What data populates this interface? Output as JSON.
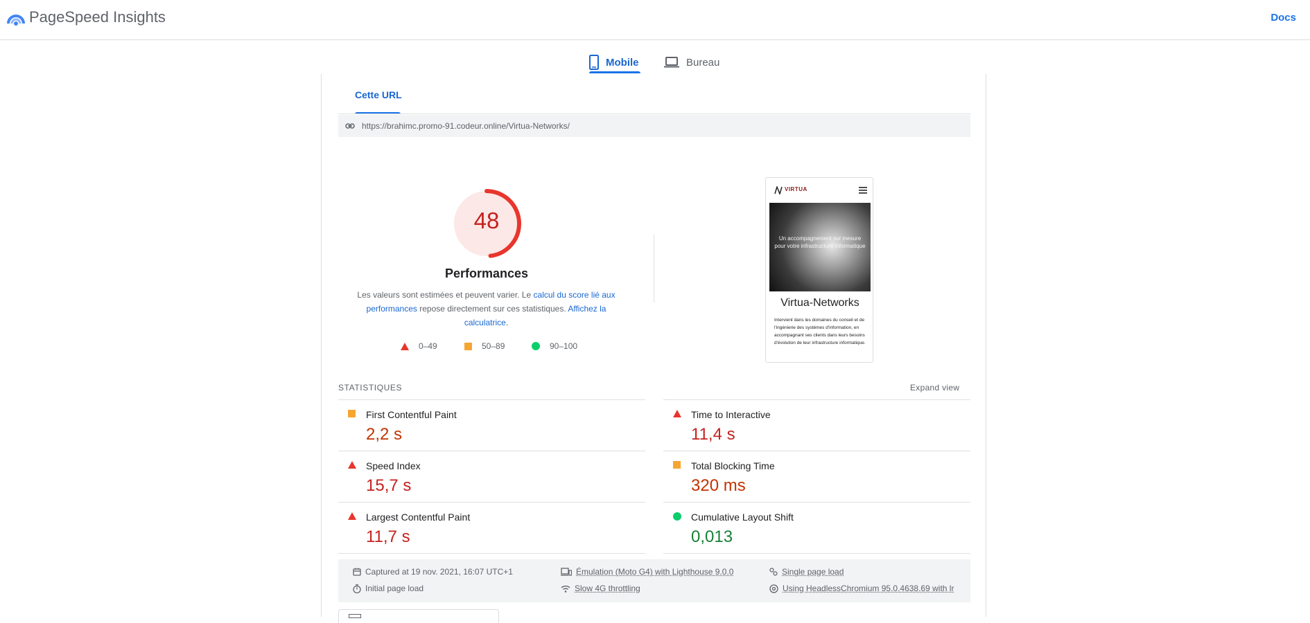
{
  "header": {
    "brand": "PageSpeed Insights",
    "docs_label": "Docs"
  },
  "device_tabs": [
    {
      "label": "Mobile",
      "selected": true
    },
    {
      "label": "Bureau",
      "selected": false
    }
  ],
  "url_tab": {
    "label": "Cette URL"
  },
  "url": "https://brahimc.promo-91.codeur.online/Virtua-Networks/",
  "score": {
    "value": "48",
    "fraction": 0.48,
    "title": "Performances",
    "desc_1": "Les valeurs sont estimées et peuvent varier. Le ",
    "desc_link_1": "calcul du score lié aux performances",
    "desc_2": " repose directement sur ces statistiques. ",
    "desc_link_2": "Affichez la calculatrice",
    "desc_3": ".",
    "legend": [
      {
        "range": "0–49",
        "shape": "triangle",
        "color": "#e8362d"
      },
      {
        "range": "50–89",
        "shape": "square",
        "color": "#f7a531"
      },
      {
        "range": "90–100",
        "shape": "circle",
        "color": "#0cce6b"
      }
    ]
  },
  "preview": {
    "logo_text": "VIRTUA",
    "hero_text_1": "Un accompagnement sur mesure",
    "hero_text_2": "pour votre infrastructure informatique",
    "title": "Virtua-Networks",
    "body": "Intervient dans les domaines du conseil et de l'ingénierie des systèmes d'information, en accompagnant ses clients dans leurs besoins d'évolution de leur infrastructure informatique."
  },
  "stats": {
    "heading": "STATISTIQUES",
    "expand_label": "Expand view",
    "metrics": [
      {
        "label": "First Contentful Paint",
        "value": "2,2 s",
        "status": "average",
        "icon": "orange-square-icon",
        "color": "#c33300"
      },
      {
        "label": "Time to Interactive",
        "value": "11,4 s",
        "status": "fail",
        "icon": "red-triangle-icon",
        "color": "#c5221f"
      },
      {
        "label": "Speed Index",
        "value": "15,7 s",
        "status": "fail",
        "icon": "red-triangle-icon",
        "color": "#c5221f"
      },
      {
        "label": "Total Blocking Time",
        "value": "320 ms",
        "status": "average",
        "icon": "orange-square-icon",
        "color": "#c33300"
      },
      {
        "label": "Largest Contentful Paint",
        "value": "11,7 s",
        "status": "fail",
        "icon": "red-triangle-icon",
        "color": "#c5221f"
      },
      {
        "label": "Cumulative Layout Shift",
        "value": "0,013",
        "status": "pass",
        "icon": "green-circle-icon",
        "color": "#188038"
      }
    ]
  },
  "run_info": {
    "captured": "Captured at 19 nov. 2021, 16:07 UTC+1",
    "emulation": "Émulation (Moto G4) with Lighthouse 9.0.0",
    "single_load": "Single page load",
    "initial_load": "Initial page load",
    "throttling": "Slow 4G throttling",
    "browser": "Using HeadlessChromium 95.0.4638.69 with lr"
  },
  "colors": {
    "accent": "#1a73e8",
    "fail": "#e8362d",
    "average": "#f7a531",
    "pass": "#0cce6b"
  }
}
